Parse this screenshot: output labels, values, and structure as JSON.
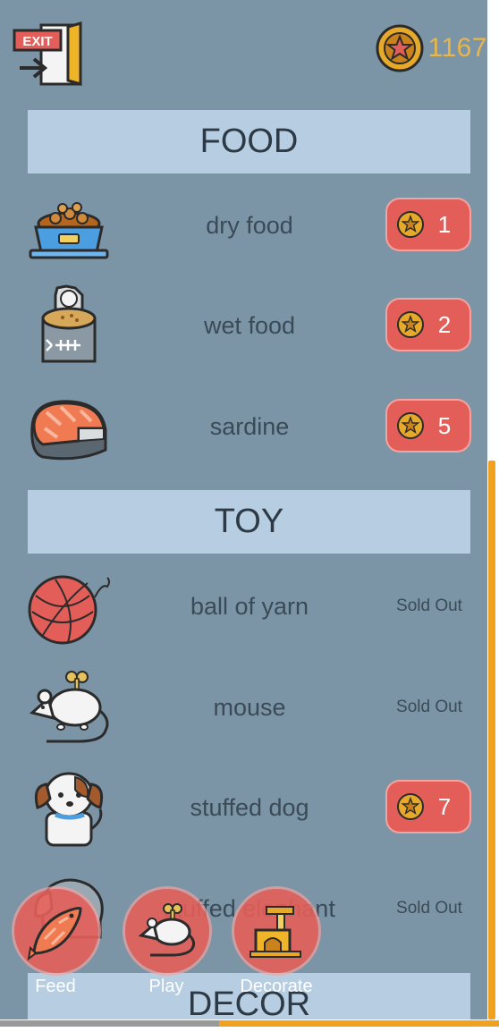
{
  "header": {
    "coin_count": "1167",
    "exit_icon": "exit-door-icon",
    "coin_icon": "star-coin-icon"
  },
  "sections": {
    "food": "FOOD",
    "toy": "TOY",
    "decor": "DECOR"
  },
  "items": [
    {
      "name": "dry food",
      "price": "1",
      "icon": "food-bowl-icon"
    },
    {
      "name": "wet food",
      "price": "2",
      "icon": "cat-food-can-icon"
    },
    {
      "name": "sardine",
      "price": "5",
      "icon": "fish-steak-icon"
    },
    {
      "name": "ball of yarn",
      "status": "Sold Out",
      "icon": "yarn-ball-icon"
    },
    {
      "name": "mouse",
      "status": "Sold Out",
      "icon": "wind-up-mouse-icon"
    },
    {
      "name": "stuffed dog",
      "price": "7",
      "icon": "puppy-icon"
    },
    {
      "name": "stuffed elephant",
      "status": "Sold Out",
      "icon": "elephant-icon"
    }
  ],
  "tabs": [
    {
      "label": "Feed",
      "icon": "fish-icon"
    },
    {
      "label": "Play",
      "icon": "mouse-icon"
    },
    {
      "label": "Decorate",
      "icon": "cat-tree-icon"
    }
  ],
  "colors": {
    "background": "#7b95a6",
    "header_bg": "#b7cee2",
    "price_button": "#e45e59",
    "coin_text": "#e8b64a",
    "scroll_thumb": "#f0a21e"
  }
}
